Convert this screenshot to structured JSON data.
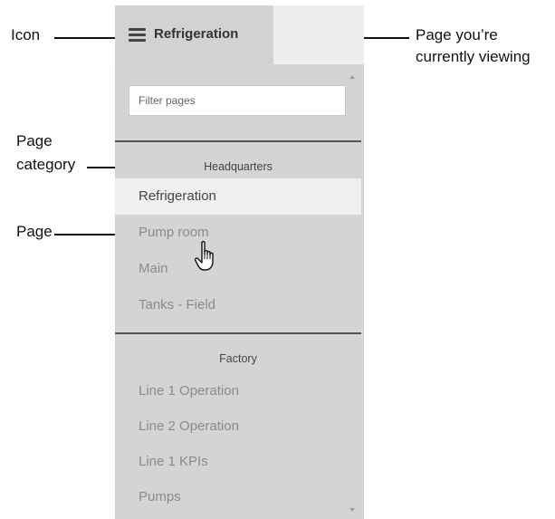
{
  "annotations": {
    "icon": "Icon",
    "page_viewing": "Page you’re\ncurrently viewing",
    "page_viewing_line1": "Page you’re",
    "page_viewing_line2": "currently viewing",
    "page_category_line1": "Page",
    "page_category_line2": "category",
    "page": "Page"
  },
  "header": {
    "icon": "hamburger-menu-icon",
    "title": "Refrigeration"
  },
  "sidebar": {
    "filter_placeholder": "Filter pages",
    "categories": [
      {
        "name": "Headquarters",
        "pages": [
          "Refrigeration",
          "Pump room",
          "Main",
          "Tanks - Field"
        ]
      },
      {
        "name": "Factory",
        "pages": [
          "Line 1 Operation",
          "Line 2 Operation",
          "Line 1 KPIs",
          "Pumps"
        ]
      }
    ],
    "active_page": "Refrigeration"
  },
  "colors": {
    "panel_bg": "#d4d4d4",
    "active_bg": "#efefef",
    "header_bg": "#d2d2d2"
  }
}
